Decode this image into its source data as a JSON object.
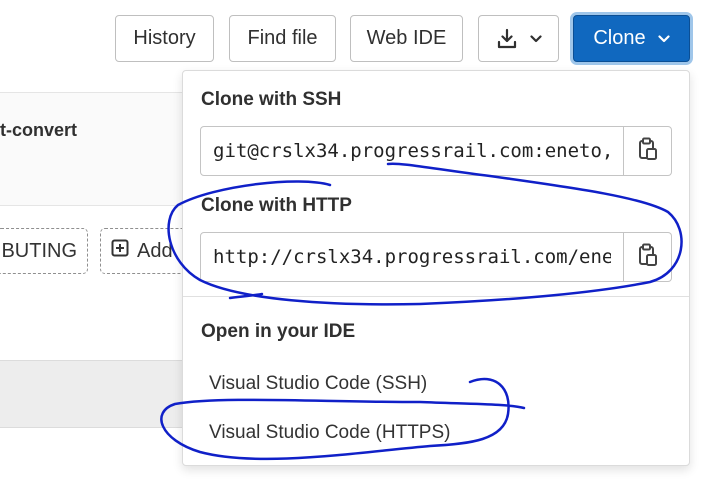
{
  "toolbar": {
    "history_label": "History",
    "find_file_label": "Find file",
    "web_ide_label": "Web IDE",
    "download_icon": "download-icon",
    "clone_label": "Clone"
  },
  "background": {
    "repo_title_fragment": "t-convert",
    "contributing_fragment": "BUTING",
    "add_fragment": "Add"
  },
  "clone_dropdown": {
    "ssh": {
      "label": "Clone with SSH",
      "value": "git@crslx34.progressrail.com:eneto,"
    },
    "http": {
      "label": "Clone with HTTP",
      "value": "http://crslx34.progressrail.com/ene"
    },
    "ide": {
      "label": "Open in your IDE",
      "items": [
        {
          "label": "Visual Studio Code (SSH)"
        },
        {
          "label": "Visual Studio Code (HTTPS)"
        }
      ]
    }
  },
  "colors": {
    "clone_button": "#1068bf",
    "annotation_ink": "#1020c8"
  }
}
